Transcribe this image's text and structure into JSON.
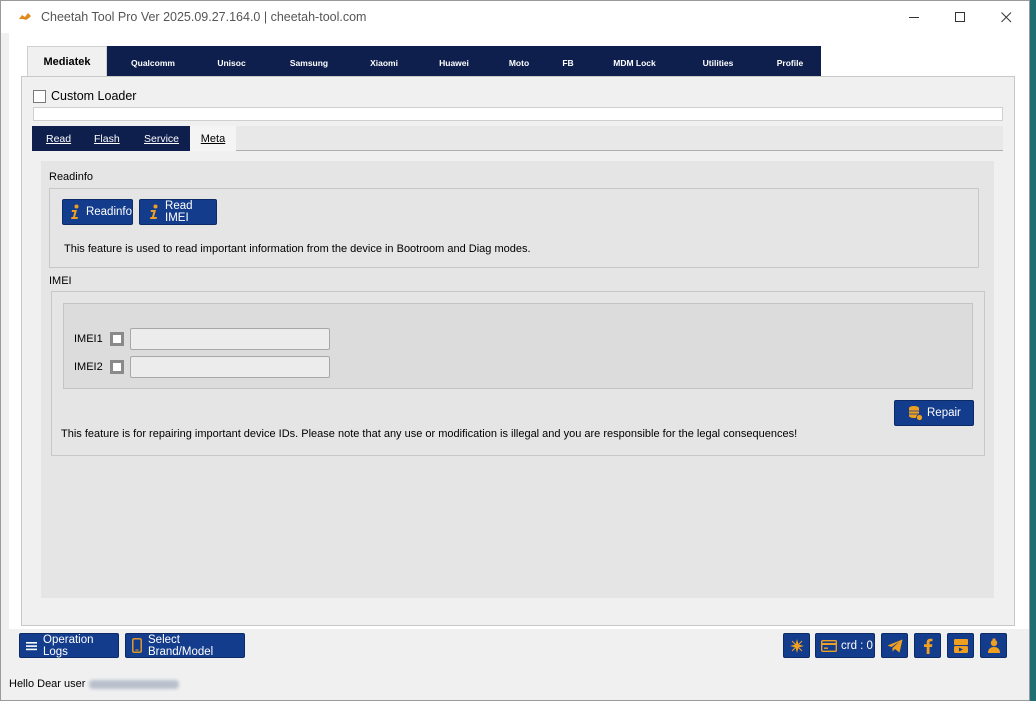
{
  "window": {
    "title": "Cheetah Tool Pro Ver 2025.09.27.164.0 | cheetah-tool.com",
    "minimize_icon": "minimize-icon",
    "maximize_icon": "maximize-icon",
    "close_icon": "close-icon"
  },
  "main_tabs": {
    "active": "Mediatek",
    "items": [
      "Qualcomm",
      "Unisoc",
      "Samsung",
      "Xiaomi",
      "Huawei",
      "Moto",
      "FB",
      "MDM Lock",
      "Utilities",
      "Profile"
    ]
  },
  "custom_loader": {
    "label": "Custom Loader",
    "checked": false
  },
  "sub_tabs": {
    "items": [
      "Read",
      "Flash",
      "Service"
    ],
    "active": "Meta"
  },
  "readinfo": {
    "section_label": "Readinfo",
    "readinfo_button": "Readinfo",
    "read_imei_button": "Read IMEI",
    "description": "This feature is used to read important information from the device in Bootroom and Diag modes."
  },
  "imei": {
    "section_label": "IMEI",
    "imei1_label": "IMEI1",
    "imei2_label": "IMEI2",
    "imei1_value": "",
    "imei2_value": "",
    "repair_button": "Repair",
    "description": "This feature is for repairing important device IDs. Please note that any use or modification is illegal and you are responsible for the legal consequences!"
  },
  "bottom": {
    "operation_logs": "Operation Logs",
    "select_brand": "Select Brand/Model",
    "credits": "crd : 0"
  },
  "status": {
    "greeting": "Hello Dear user"
  },
  "colors": {
    "accent": "#143c8c",
    "tab_dark": "#0e1f4e",
    "icon_gold": "#f0a020"
  }
}
